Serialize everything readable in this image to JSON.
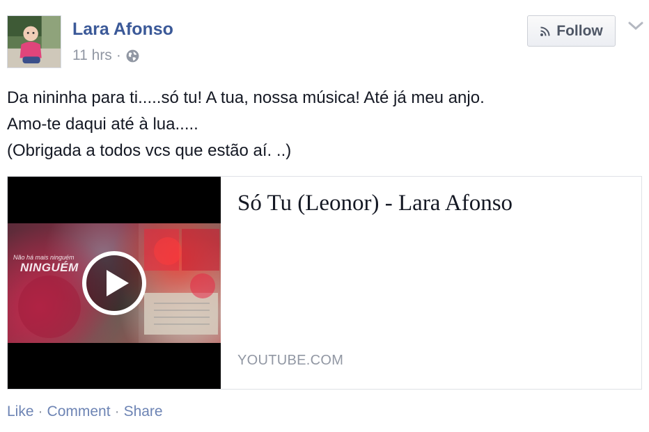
{
  "post": {
    "author": "Lara Afonso",
    "time": "11 hrs",
    "separator": "·",
    "privacy_icon": "globe-icon",
    "follow_label": "Follow",
    "follow_icon": "rss-icon",
    "menu_icon": "chevron-down-icon",
    "message_lines": [
      "Da nininha para ti.....só tu! A tua, nossa música! Até já meu anjo.",
      "Amo-te daqui até à lua.....",
      "(Obrigada a todos vcs que estão aí. ..)"
    ]
  },
  "attachment": {
    "title": "Só Tu (Leonor) - Lara Afonso",
    "source": "YOUTUBE.COM",
    "thumbnail_caption_small": "Não há mais ninguém",
    "thumbnail_caption": "NINGUÉM",
    "play_icon": "play-icon"
  },
  "actions": {
    "like": "Like",
    "comment": "Comment",
    "share": "Share",
    "separator": "·"
  },
  "colors": {
    "link_blue": "#3b5998",
    "action_blue": "#6d84b4",
    "meta_gray": "#9197a3",
    "text": "#141823"
  }
}
